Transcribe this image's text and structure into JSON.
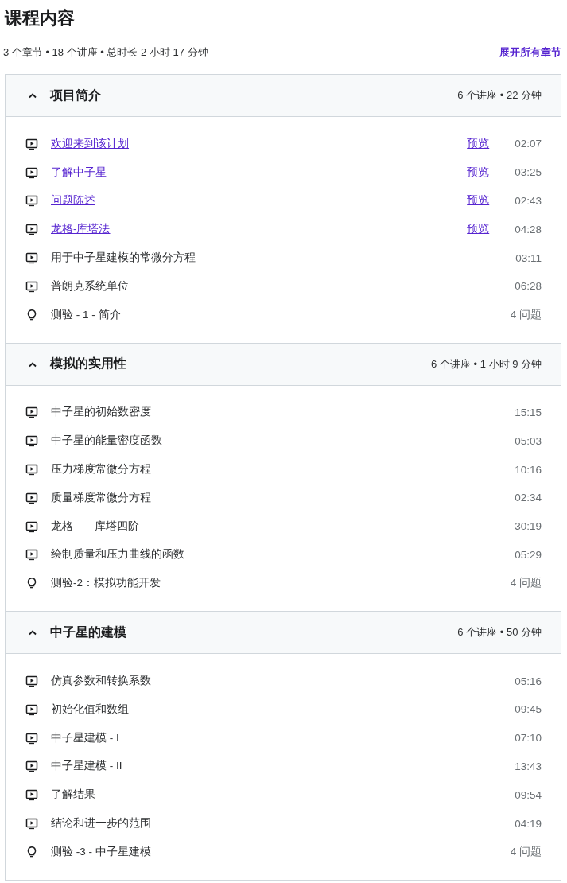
{
  "title": "课程内容",
  "summary": "3 个章节 • 18 个讲座 • 总时长 2 小时 17 分钟",
  "expand_all": "展开所有章节",
  "sections": [
    {
      "title": "项目简介",
      "meta": "6 个讲座 • 22 分钟",
      "expanded": true,
      "items": [
        {
          "kind": "video",
          "title": "欢迎来到该计划",
          "linked": true,
          "preview": "预览",
          "duration": "02:07"
        },
        {
          "kind": "video",
          "title": "了解中子星",
          "linked": true,
          "preview": "预览",
          "duration": "03:25"
        },
        {
          "kind": "video",
          "title": "问题陈述",
          "linked": true,
          "preview": "预览",
          "duration": "02:43"
        },
        {
          "kind": "video",
          "title": "龙格-库塔法",
          "linked": true,
          "preview": "预览",
          "duration": "04:28"
        },
        {
          "kind": "video",
          "title": "用于中子星建模的常微分方程",
          "linked": false,
          "duration": "03:11"
        },
        {
          "kind": "video",
          "title": "普朗克系统单位",
          "linked": false,
          "duration": "06:28"
        },
        {
          "kind": "quiz",
          "title": "测验 - 1 - 简介",
          "linked": false,
          "duration": "4 问题"
        }
      ]
    },
    {
      "title": "模拟的实用性",
      "meta": "6 个讲座 • 1 小时 9 分钟",
      "expanded": true,
      "items": [
        {
          "kind": "video",
          "title": "中子星的初始数密度",
          "linked": false,
          "duration": "15:15"
        },
        {
          "kind": "video",
          "title": "中子星的能量密度函数",
          "linked": false,
          "duration": "05:03"
        },
        {
          "kind": "video",
          "title": "压力梯度常微分方程",
          "linked": false,
          "duration": "10:16"
        },
        {
          "kind": "video",
          "title": "质量梯度常微分方程",
          "linked": false,
          "duration": "02:34"
        },
        {
          "kind": "video",
          "title": "龙格——库塔四阶",
          "linked": false,
          "duration": "30:19"
        },
        {
          "kind": "video",
          "title": "绘制质量和压力曲线的函数",
          "linked": false,
          "duration": "05:29"
        },
        {
          "kind": "quiz",
          "title": "测验-2：模拟功能开发",
          "linked": false,
          "duration": "4 问题"
        }
      ]
    },
    {
      "title": "中子星的建模",
      "meta": "6 个讲座 • 50 分钟",
      "expanded": true,
      "items": [
        {
          "kind": "video",
          "title": "仿真参数和转换系数",
          "linked": false,
          "duration": "05:16"
        },
        {
          "kind": "video",
          "title": "初始化值和数组",
          "linked": false,
          "duration": "09:45"
        },
        {
          "kind": "video",
          "title": "中子星建模 - I",
          "linked": false,
          "duration": "07:10"
        },
        {
          "kind": "video",
          "title": "中子星建模 - II",
          "linked": false,
          "duration": "13:43"
        },
        {
          "kind": "video",
          "title": "了解结果",
          "linked": false,
          "duration": "09:54"
        },
        {
          "kind": "video",
          "title": "结论和进一步的范围",
          "linked": false,
          "duration": "04:19"
        },
        {
          "kind": "quiz",
          "title": "测验 -3 - 中子星建模",
          "linked": false,
          "duration": "4 问题"
        }
      ]
    }
  ]
}
